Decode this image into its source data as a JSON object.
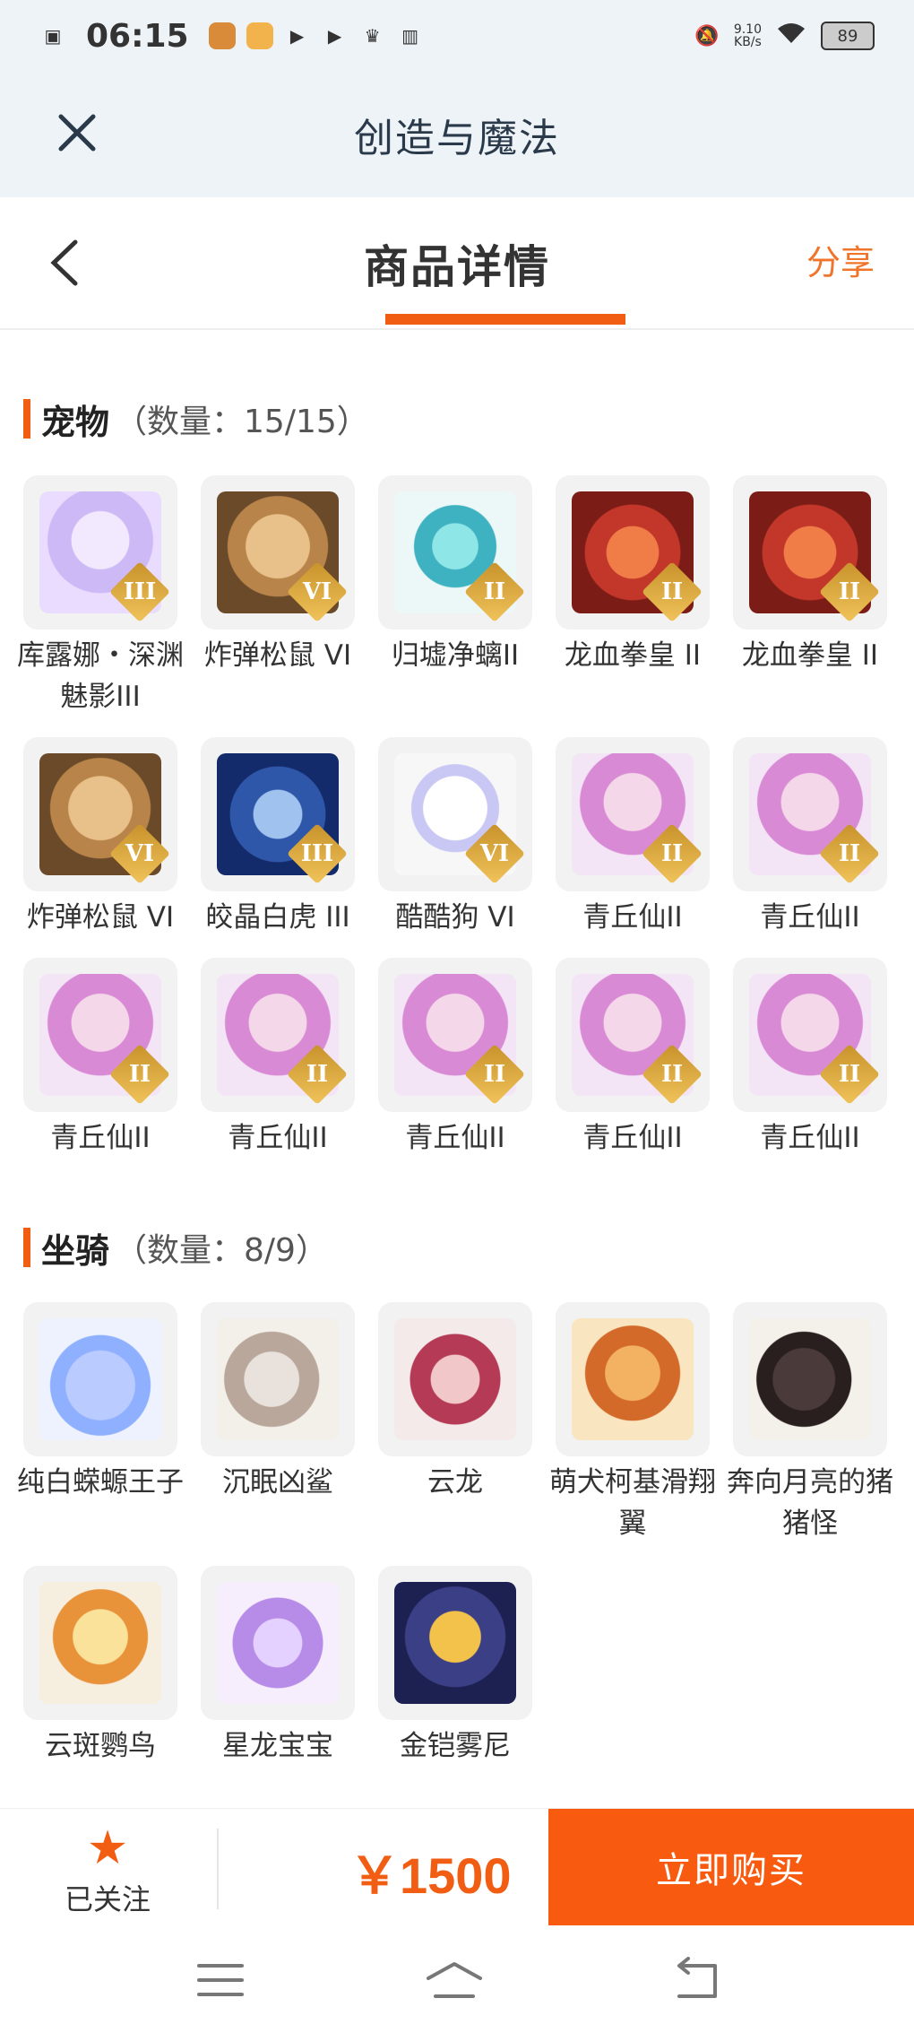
{
  "status": {
    "time": "06:15",
    "net_speed_top": "9.10",
    "net_speed_bottom": "KB/s",
    "battery": "89"
  },
  "title_bar": {
    "title": "创造与魔法"
  },
  "sub_header": {
    "title": "商品详情",
    "share": "分享"
  },
  "sections": {
    "pets": {
      "title": "宠物",
      "count": "（数量：15/15）",
      "items": [
        {
          "name": "库露娜・深渊魅影III",
          "badge": "III",
          "icon": "white-girl-pet"
        },
        {
          "name": "炸弹松鼠 VI",
          "badge": "VI",
          "icon": "squirrel-pet"
        },
        {
          "name": "归墟净螭II",
          "badge": "II",
          "icon": "cyan-dragon-pet"
        },
        {
          "name": "龙血拳皇 II",
          "badge": "II",
          "icon": "red-beast-pet"
        },
        {
          "name": "龙血拳皇 II",
          "badge": "II",
          "icon": "red-beast-pet"
        },
        {
          "name": "炸弹松鼠 VI",
          "badge": "VI",
          "icon": "squirrel-pet"
        },
        {
          "name": "皎晶白虎 III",
          "badge": "III",
          "icon": "tiger-pet"
        },
        {
          "name": "酷酷狗 VI",
          "badge": "VI",
          "icon": "goggle-dog-pet"
        },
        {
          "name": "青丘仙II",
          "badge": "II",
          "icon": "fox-fairy-pet"
        },
        {
          "name": "青丘仙II",
          "badge": "II",
          "icon": "fox-fairy-pet"
        },
        {
          "name": "青丘仙II",
          "badge": "II",
          "icon": "fox-fairy-pet"
        },
        {
          "name": "青丘仙II",
          "badge": "II",
          "icon": "fox-fairy-pet"
        },
        {
          "name": "青丘仙II",
          "badge": "II",
          "icon": "fox-fairy-pet"
        },
        {
          "name": "青丘仙II",
          "badge": "II",
          "icon": "fox-fairy-pet"
        },
        {
          "name": "青丘仙II",
          "badge": "II",
          "icon": "fox-fairy-pet"
        }
      ]
    },
    "mounts": {
      "title": "坐骑",
      "count": "（数量：8/9）",
      "items": [
        {
          "name": "纯白蝾螈王子",
          "icon": "axolotl-mount"
        },
        {
          "name": "沉眠凶鲨",
          "icon": "shark-mount"
        },
        {
          "name": "云龙",
          "icon": "cloud-dragon-mount"
        },
        {
          "name": "萌犬柯基滑翔翼",
          "icon": "corgi-glider-mount"
        },
        {
          "name": "奔向月亮的猪猪怪",
          "icon": "pig-mount"
        },
        {
          "name": "云斑鹦鸟",
          "icon": "parrot-mount"
        },
        {
          "name": "星龙宝宝",
          "icon": "star-dragon-mount"
        },
        {
          "name": "金铠雾尼",
          "icon": "golden-armor-mount"
        }
      ]
    }
  },
  "bottom_bar": {
    "follow_label": "已关注",
    "price": "￥1500",
    "buy_label": "立即购买"
  },
  "colors": {
    "accent": "#f25d14",
    "header_bg": "#eef3f8"
  }
}
